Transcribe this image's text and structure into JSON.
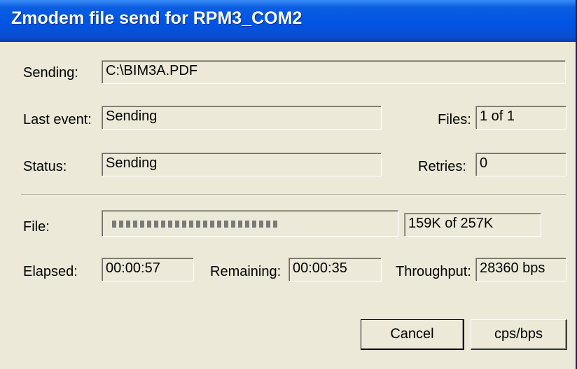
{
  "window": {
    "title": "Zmodem file send for RPM3_COM2"
  },
  "fields": {
    "sending_label": "Sending:",
    "sending_value": "C:\\BIM3A.PDF",
    "last_event_label": "Last event:",
    "last_event_value": "Sending",
    "files_label": "Files:",
    "files_value": "1 of 1",
    "status_label": "Status:",
    "status_value": "Sending",
    "retries_label": "Retries:",
    "retries_value": "0"
  },
  "progress": {
    "file_label": "File:",
    "size_text": "159K of 257K",
    "fraction": 0.62
  },
  "stats": {
    "elapsed_label": "Elapsed:",
    "elapsed_value": "00:00:57",
    "remaining_label": "Remaining:",
    "remaining_value": "00:00:35",
    "throughput_label": "Throughput:",
    "throughput_value": "28360 bps"
  },
  "buttons": {
    "cancel_label": "Cancel",
    "units_label": "cps/bps"
  }
}
